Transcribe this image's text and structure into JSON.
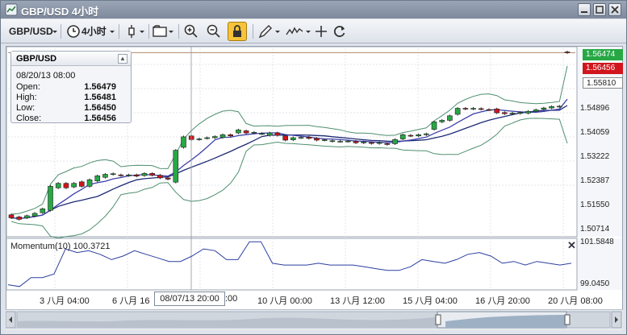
{
  "window": {
    "title": "GBP/USD 4小时"
  },
  "toolbar": {
    "symbol": "GBP/USD",
    "timeframe": "4小时"
  },
  "info": {
    "symbol": "GBP/USD",
    "datetime": "08/20/13 08:00",
    "rows": [
      {
        "label": "Open:",
        "value": "1.56479"
      },
      {
        "label": "High:",
        "value": "1.56481"
      },
      {
        "label": "Low:",
        "value": "1.56450"
      },
      {
        "label": "Close:",
        "value": "1.56456"
      }
    ]
  },
  "price_axis": {
    "labels": [
      "1.54896",
      "1.54059",
      "1.53222",
      "1.52387",
      "1.51550",
      "1.50714"
    ],
    "badges": [
      {
        "text": "1.56474",
        "color": "#27a845"
      },
      {
        "text": "1.56456",
        "color": "#d0151c"
      },
      {
        "text": "1.55810",
        "color": "#ffffff"
      }
    ]
  },
  "momentum": {
    "label": "Momentum(10) 100.3721",
    "axis_top": "101.5848",
    "axis_bottom": "99.0450"
  },
  "time_axis": {
    "labels": [
      "3 八月 04:00",
      "6 八月 16",
      ":00",
      "10 八月 00:00",
      "13 八月 12:00",
      "15 八月 04:00",
      "16 八月 20:00",
      "20 八月 08:00"
    ],
    "cursor_label": "08/07/13 20:00"
  },
  "colors": {
    "up": "#27a845",
    "down": "#d0151c",
    "bollinger": "#4f8f6f",
    "ma_fast": "#3d3fa8",
    "ma_slow": "#1d2a74",
    "momentum": "#2b3ea0"
  },
  "chart_data": {
    "type": "candlestick",
    "symbol": "GBP/USD",
    "timeframe": "4小时",
    "ylim": [
      1.504,
      1.566
    ],
    "last_price": 1.56456,
    "candles": [
      [
        1.5105,
        1.5095
      ],
      [
        1.5098,
        1.509
      ],
      [
        1.5095,
        1.5102
      ],
      [
        1.5101,
        1.511
      ],
      [
        1.5112,
        1.5125
      ],
      [
        1.512,
        1.52
      ],
      [
        1.5195,
        1.521
      ],
      [
        1.521,
        1.5195
      ],
      [
        1.5198,
        1.521
      ],
      [
        1.5215,
        1.52
      ],
      [
        1.52,
        1.5222
      ],
      [
        1.5218,
        1.5235
      ],
      [
        1.523,
        1.524
      ],
      [
        1.524,
        1.5242
      ],
      [
        1.5238,
        1.5236
      ],
      [
        1.5236,
        1.5238
      ],
      [
        1.5238,
        1.5234
      ],
      [
        1.5236,
        1.5243
      ],
      [
        1.5243,
        1.5237
      ],
      [
        1.5237,
        1.5228
      ],
      [
        1.5228,
        1.5224
      ],
      [
        1.5214,
        1.532
      ],
      [
        1.533,
        1.5365
      ],
      [
        1.5368,
        1.5356
      ],
      [
        1.5356,
        1.5358
      ],
      [
        1.536,
        1.5362
      ],
      [
        1.5362,
        1.5366
      ],
      [
        1.5363,
        1.5372
      ],
      [
        1.5372,
        1.5368
      ],
      [
        1.5378,
        1.5388
      ],
      [
        1.5385,
        1.5378
      ],
      [
        1.5378,
        1.538
      ],
      [
        1.5375,
        1.5376
      ],
      [
        1.537,
        1.5378
      ],
      [
        1.5378,
        1.537
      ],
      [
        1.5368,
        1.5354
      ],
      [
        1.5355,
        1.5362
      ],
      [
        1.5362,
        1.5363
      ],
      [
        1.5364,
        1.536
      ],
      [
        1.536,
        1.5354
      ],
      [
        1.5354,
        1.5355
      ],
      [
        1.535,
        1.5352
      ],
      [
        1.535,
        1.535
      ],
      [
        1.535,
        1.5351
      ],
      [
        1.535,
        1.5345
      ],
      [
        1.5345,
        1.5348
      ],
      [
        1.5346,
        1.5343
      ],
      [
        1.5343,
        1.5346
      ],
      [
        1.5342,
        1.534
      ],
      [
        1.5342,
        1.5356
      ],
      [
        1.5358,
        1.5372
      ],
      [
        1.537,
        1.5368
      ],
      [
        1.5368,
        1.5372
      ],
      [
        1.5372,
        1.5375
      ],
      [
        1.539,
        1.5415
      ],
      [
        1.5415,
        1.542
      ],
      [
        1.542,
        1.5435
      ],
      [
        1.544,
        1.546
      ],
      [
        1.546,
        1.5458
      ],
      [
        1.5458,
        1.546
      ],
      [
        1.5459,
        1.5457
      ],
      [
        1.5456,
        1.5455
      ],
      [
        1.5458,
        1.5445
      ],
      [
        1.5446,
        1.5442
      ],
      [
        1.5442,
        1.5444
      ],
      [
        1.5443,
        1.5446
      ],
      [
        1.5444,
        1.545
      ],
      [
        1.545,
        1.5455
      ],
      [
        1.5457,
        1.5461
      ],
      [
        1.5461,
        1.5466
      ],
      [
        1.5466,
        1.5467
      ],
      [
        1.56479,
        1.56456
      ]
    ],
    "momentum": [
      99.2,
      99.1,
      99.6,
      99.6,
      99.8,
      101.2,
      101.0,
      101.1,
      100.9,
      100.6,
      100.8,
      101.1,
      100.9,
      100.7,
      100.5,
      100.5,
      100.8,
      101.2,
      101.1,
      100.6,
      100.6,
      101.6,
      101.6,
      100.4,
      100.3,
      100.3,
      100.3,
      100.4,
      100.3,
      100.3,
      100.3,
      100.2,
      100.1,
      100.0,
      100.0,
      100.2,
      100.6,
      100.5,
      100.4,
      100.6,
      100.9,
      101.0,
      100.8,
      100.4,
      100.5,
      100.3,
      100.5,
      100.4,
      100.3,
      100.4
    ]
  }
}
